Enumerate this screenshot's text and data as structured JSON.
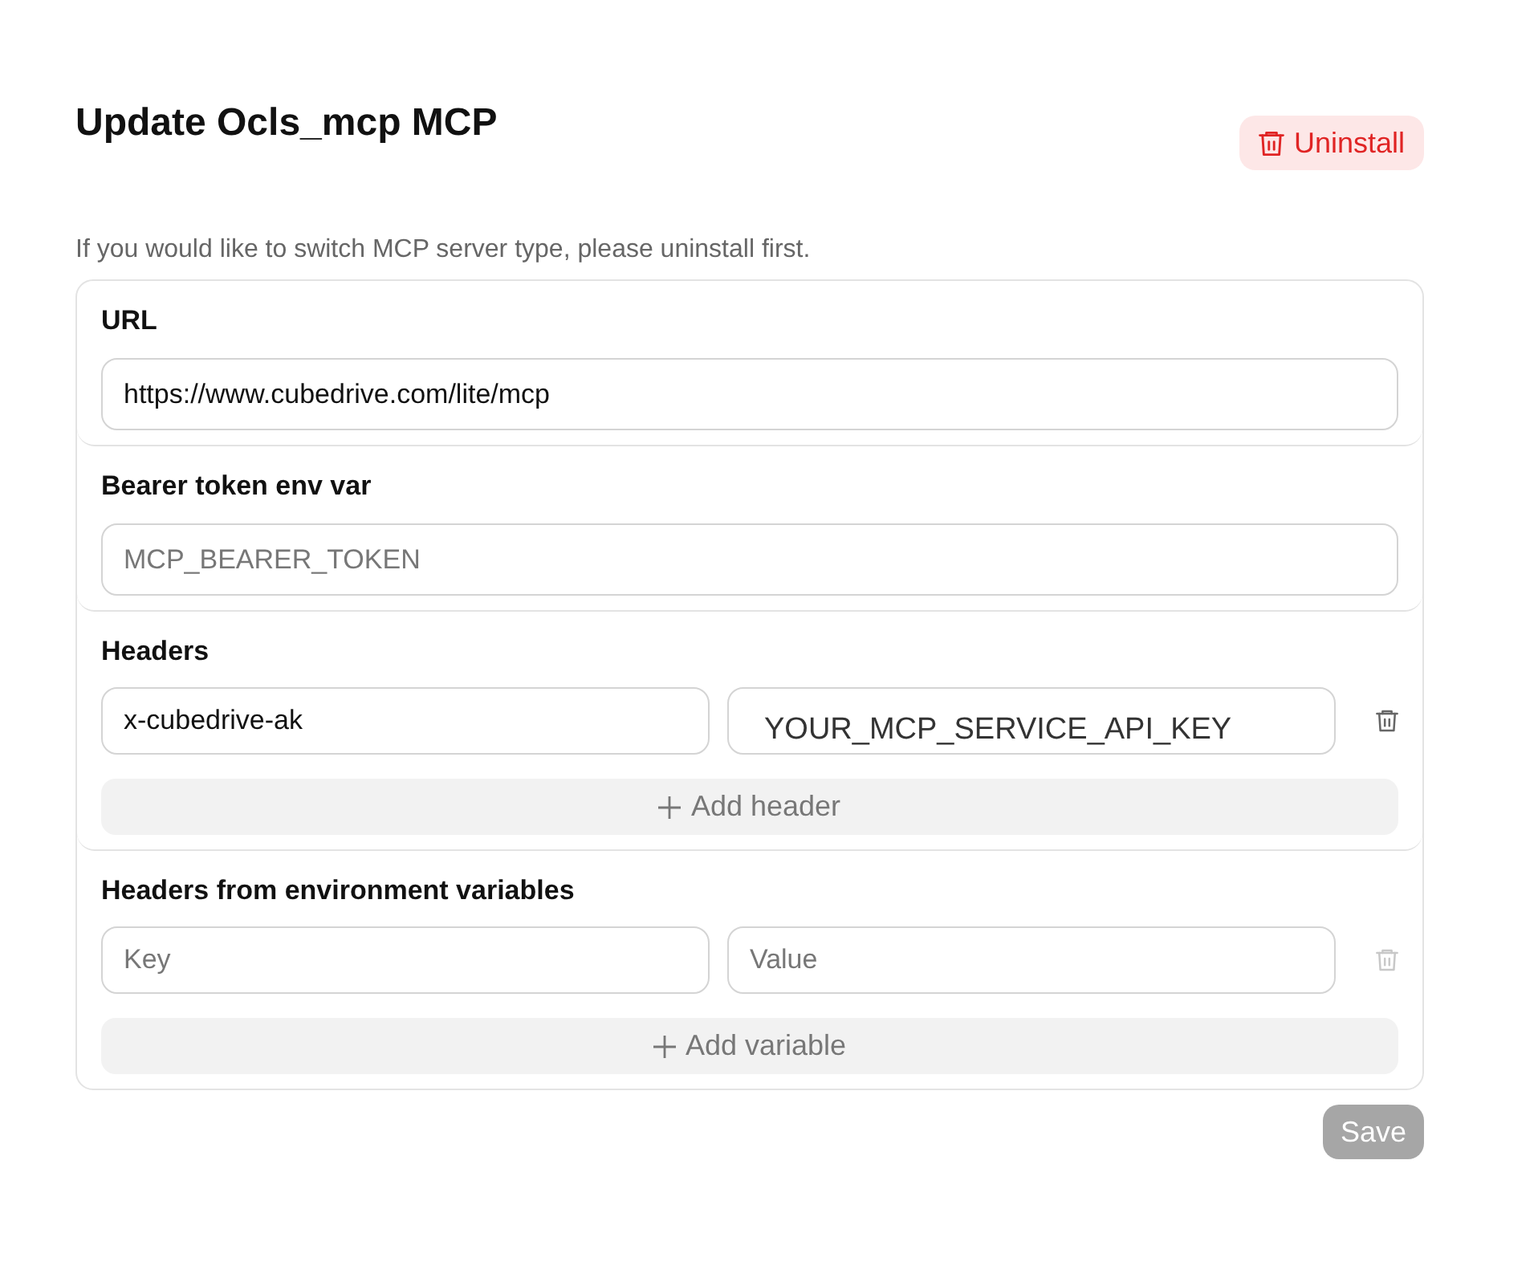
{
  "title": "Update Ocls_mcp MCP",
  "uninstall_button": {
    "label": "Uninstall"
  },
  "notice": "If you would like to switch MCP server type, please uninstall first.",
  "sections": [
    {
      "kind": "field",
      "label": "URL",
      "field": {
        "value": "https://www.cubedrive.com/lite/mcp"
      }
    },
    {
      "kind": "field",
      "label": "Bearer token env var",
      "field": {
        "placeholder": "MCP_BEARER_TOKEN"
      }
    },
    {
      "kind": "pairs",
      "label": "Headers",
      "rows": [
        {
          "key": {
            "value": "x-cubedrive-ak"
          },
          "value": {
            "value": "YOUR_MCP_SERVICE_API_KEY"
          },
          "delete_disabled": false
        }
      ],
      "add_button": "Add header"
    },
    {
      "kind": "pairs",
      "label": "Headers from environment variables",
      "rows": [
        {
          "key": {
            "placeholder": "Key"
          },
          "value": {
            "placeholder": "Value"
          },
          "delete_disabled": true
        }
      ],
      "add_button": "Add variable"
    }
  ],
  "save_button": {
    "label": "Save",
    "disabled": true
  }
}
